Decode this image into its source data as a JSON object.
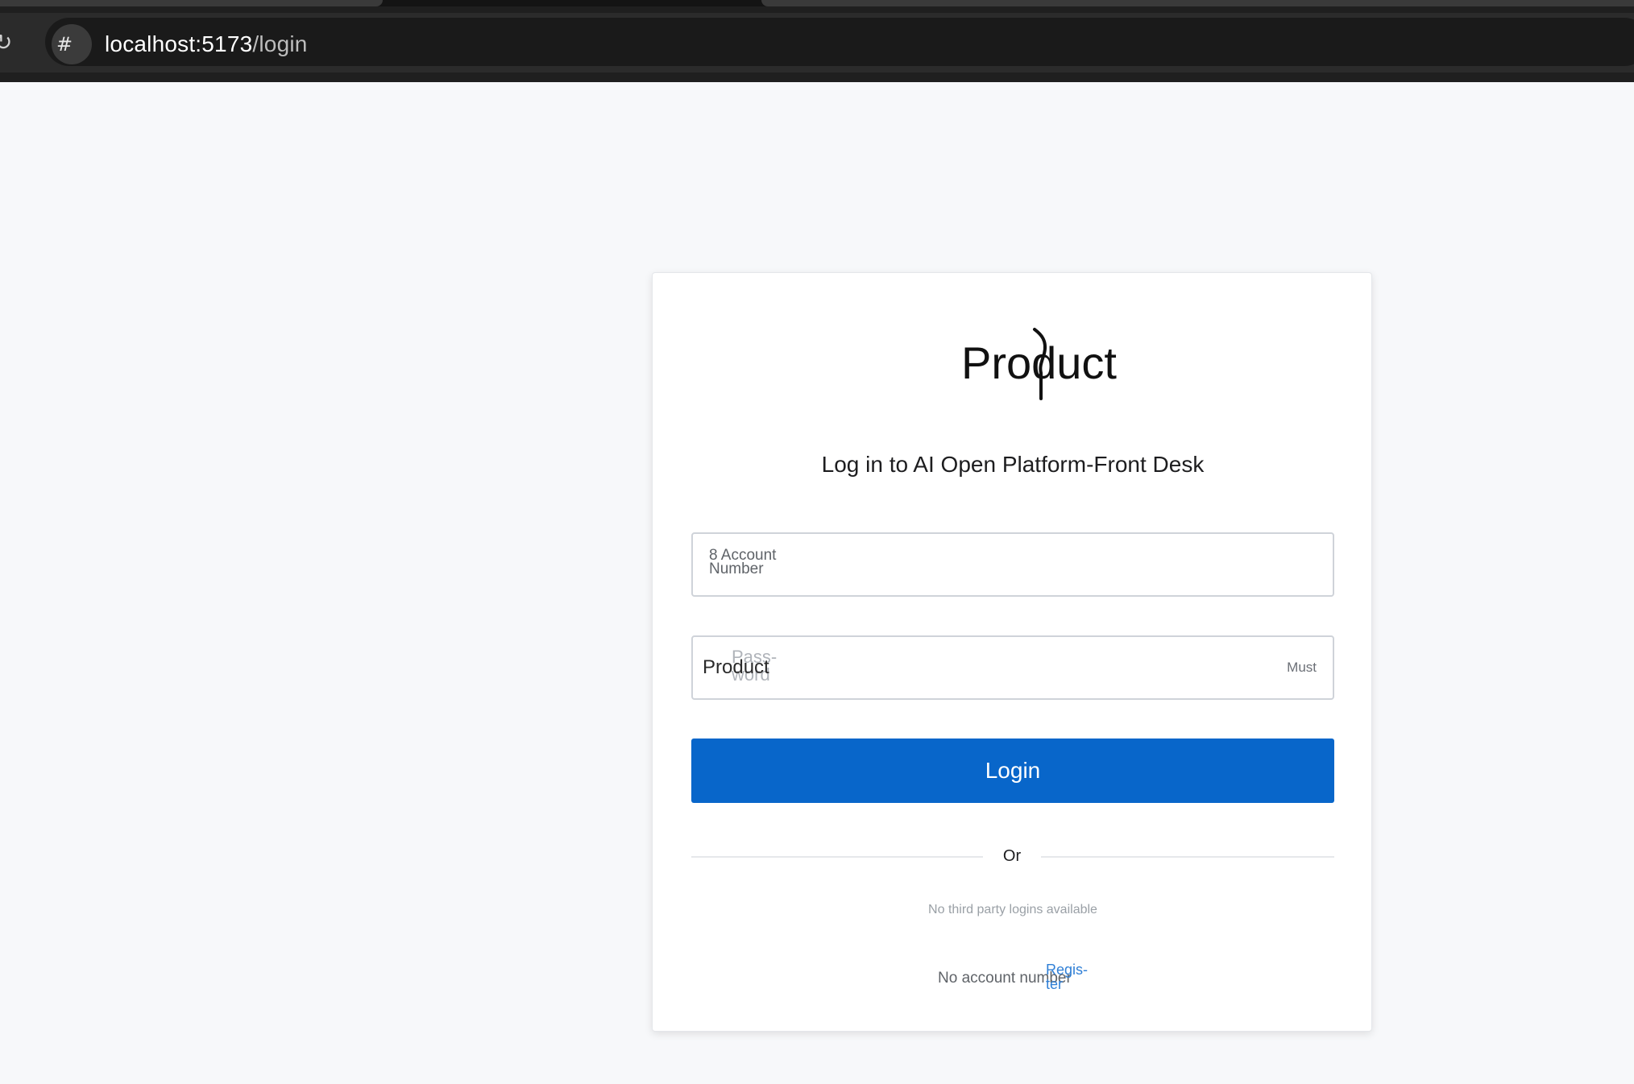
{
  "browser": {
    "site_info_icon": "#",
    "url_host": "localhost:5173",
    "url_path": "/login"
  },
  "login": {
    "logo_text": "Product",
    "subtitle": "Log in to AI Open Platform-Front Desk",
    "account_label": "8 Account Number",
    "password_value": "Product",
    "password_placeholder": "Pass-word",
    "password_hint": "Must",
    "login_button": "Login",
    "divider_text": "Or",
    "third_party_text": "No third party logins available",
    "no_account_text": "No account number",
    "register_link": "Regis-ter"
  },
  "colors": {
    "primary": "#0866ca",
    "link": "#2f7fd6",
    "page_bg": "#f7f8fa"
  }
}
